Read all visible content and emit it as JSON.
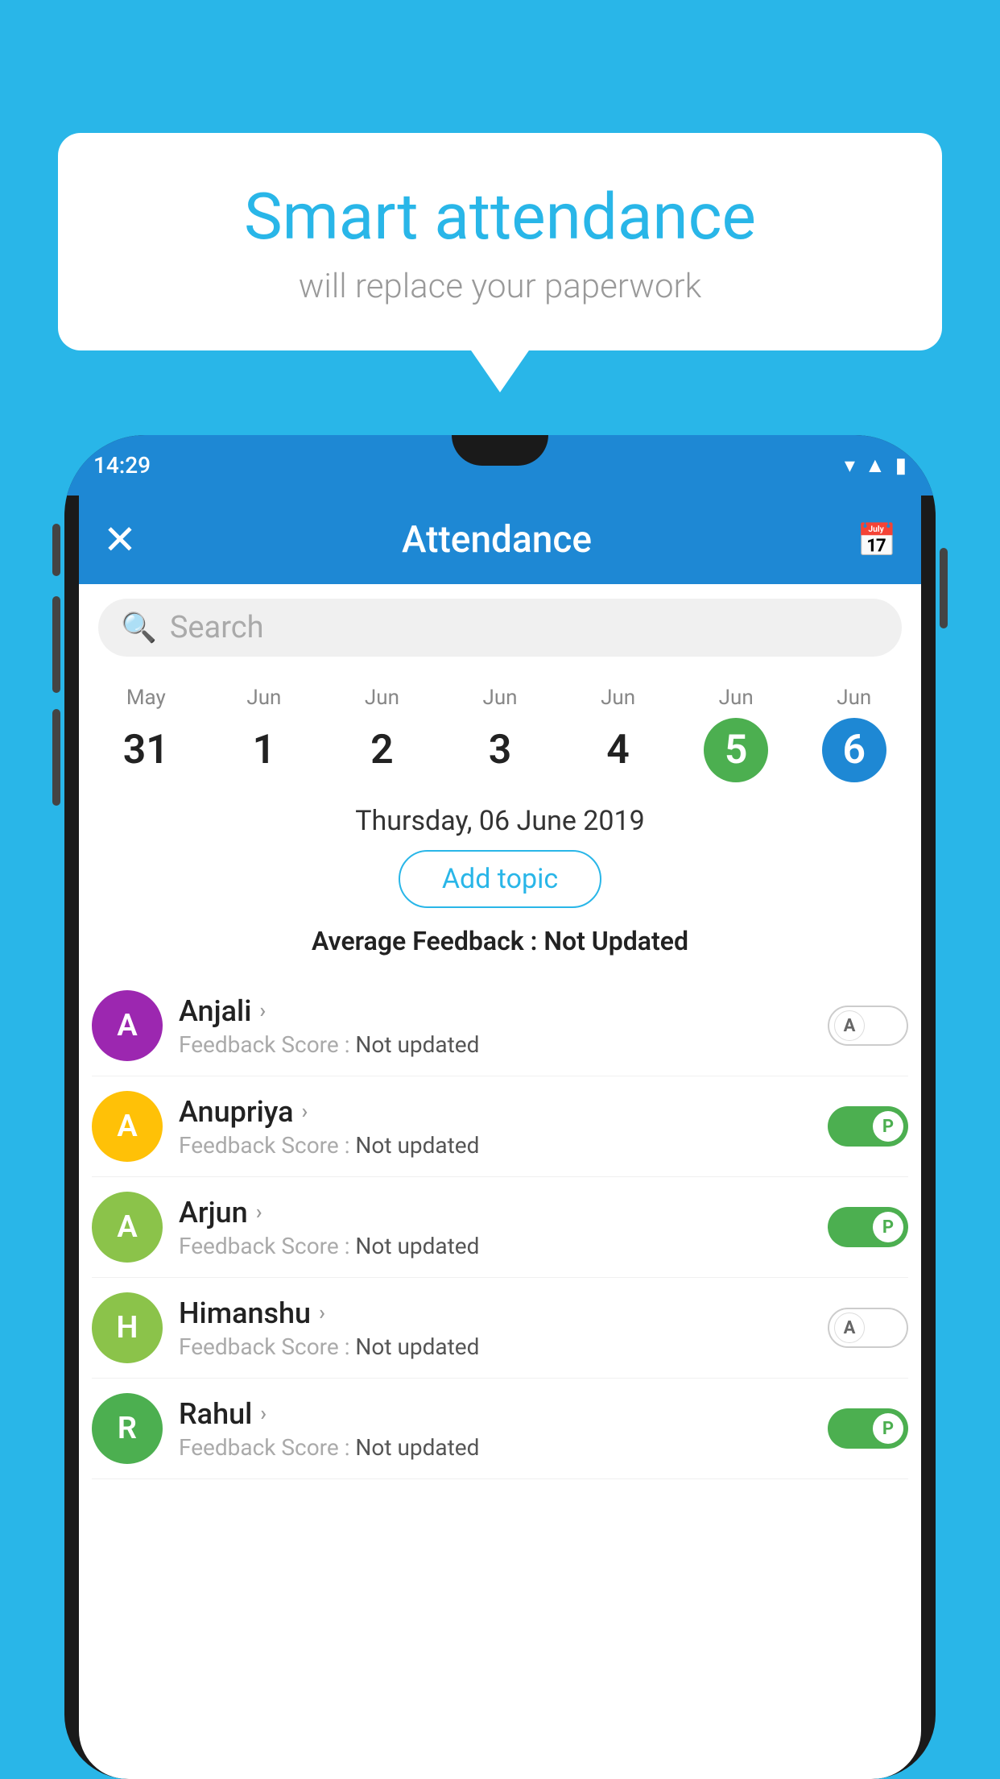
{
  "background_color": "#29b6e8",
  "bubble": {
    "title": "Smart attendance",
    "subtitle": "will replace your paperwork"
  },
  "status_bar": {
    "time": "14:29",
    "wifi_icon": "wifi-icon",
    "signal_icon": "signal-icon",
    "battery_icon": "battery-icon"
  },
  "app_bar": {
    "title": "Attendance",
    "close_label": "✕",
    "calendar_icon": "calendar-icon"
  },
  "search": {
    "placeholder": "Search"
  },
  "calendar": {
    "days": [
      {
        "month": "May",
        "date": "31",
        "style": "normal"
      },
      {
        "month": "Jun",
        "date": "1",
        "style": "normal"
      },
      {
        "month": "Jun",
        "date": "2",
        "style": "normal"
      },
      {
        "month": "Jun",
        "date": "3",
        "style": "normal"
      },
      {
        "month": "Jun",
        "date": "4",
        "style": "normal"
      },
      {
        "month": "Jun",
        "date": "5",
        "style": "green"
      },
      {
        "month": "Jun",
        "date": "6",
        "style": "blue"
      }
    ]
  },
  "selected_date": "Thursday, 06 June 2019",
  "add_topic_label": "Add topic",
  "average_feedback_label": "Average Feedback :",
  "average_feedback_value": "Not Updated",
  "students": [
    {
      "name": "Anjali",
      "initial": "A",
      "avatar_color": "#9c27b0",
      "feedback_label": "Feedback Score :",
      "feedback_value": "Not updated",
      "toggle": "off",
      "toggle_letter": "A"
    },
    {
      "name": "Anupriya",
      "initial": "A",
      "avatar_color": "#ffc107",
      "feedback_label": "Feedback Score :",
      "feedback_value": "Not updated",
      "toggle": "on",
      "toggle_letter": "P"
    },
    {
      "name": "Arjun",
      "initial": "A",
      "avatar_color": "#8bc34a",
      "feedback_label": "Feedback Score :",
      "feedback_value": "Not updated",
      "toggle": "on",
      "toggle_letter": "P"
    },
    {
      "name": "Himanshu",
      "initial": "H",
      "avatar_color": "#8bc34a",
      "feedback_label": "Feedback Score :",
      "feedback_value": "Not updated",
      "toggle": "off",
      "toggle_letter": "A"
    },
    {
      "name": "Rahul",
      "initial": "R",
      "avatar_color": "#4caf50",
      "feedback_label": "Feedback Score :",
      "feedback_value": "Not updated",
      "toggle": "on",
      "toggle_letter": "P"
    }
  ]
}
